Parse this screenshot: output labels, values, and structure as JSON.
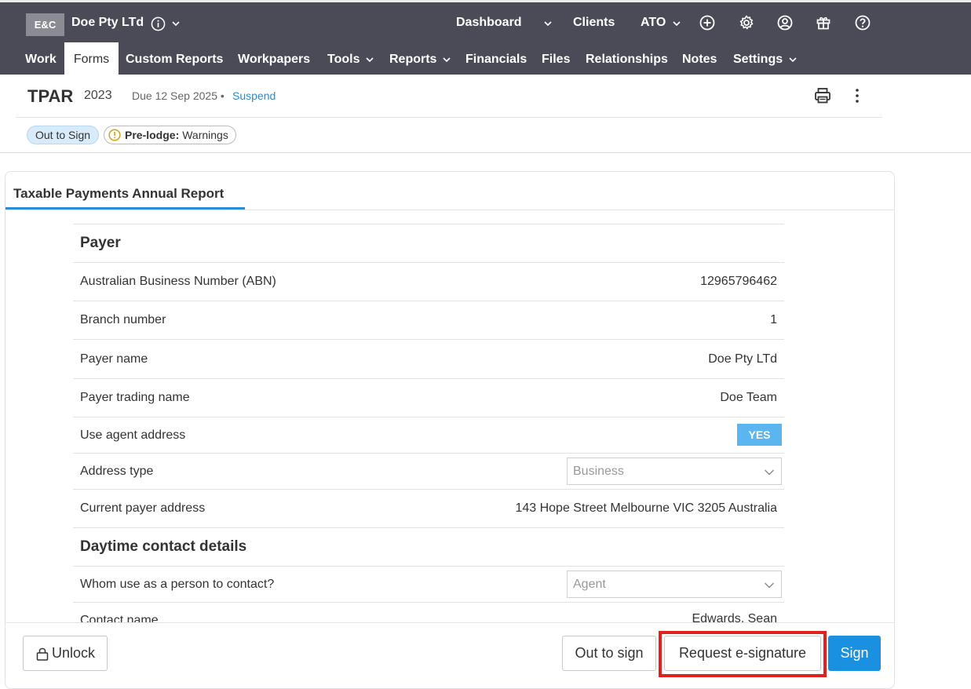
{
  "header": {
    "logo": "E&C",
    "client_name": "Doe Pty LTd",
    "links": {
      "dashboard": "Dashboard",
      "clients": "Clients",
      "ato": "ATO"
    },
    "nav": {
      "work": "Work",
      "forms": "Forms",
      "custom_reports": "Custom Reports",
      "workpapers": "Workpapers",
      "tools": "Tools",
      "reports": "Reports",
      "financials": "Financials",
      "files": "Files",
      "relationships": "Relationships",
      "notes": "Notes",
      "settings": "Settings"
    },
    "icons": [
      "info-icon",
      "plus-circle-icon",
      "gear-icon",
      "user-circle-icon",
      "gift-icon",
      "help-icon"
    ]
  },
  "form_header": {
    "title": "TPAR",
    "year": "2023",
    "due": "Due 12 Sep 2025 •",
    "suspend": "Suspend",
    "badges": {
      "status": "Out to Sign",
      "prelodge_label": "Pre-lodge:",
      "prelodge_value": "Warnings"
    }
  },
  "card": {
    "tab": "Taxable Payments Annual Report",
    "sections": {
      "payer": "Payer",
      "contact": "Daytime contact details"
    },
    "rows": {
      "abn": {
        "label": "Australian Business Number (ABN)",
        "value": "12965796462"
      },
      "branch": {
        "label": "Branch number",
        "value": "1"
      },
      "payer_name": {
        "label": "Payer name",
        "value": "Doe Pty LTd"
      },
      "trading_name": {
        "label": "Payer trading name",
        "value": "Doe Team"
      },
      "agent_address": {
        "label": "Use agent address",
        "value": "YES"
      },
      "address_type": {
        "label": "Address type",
        "value": "Business"
      },
      "current_address": {
        "label": "Current payer address",
        "value": "143 Hope Street Melbourne VIC 3205 Australia"
      },
      "whom_contact": {
        "label": "Whom use as a person to contact?",
        "value": "Agent"
      },
      "contact_name": {
        "label": "Contact name",
        "value": "Edwards, Sean"
      }
    }
  },
  "footer": {
    "unlock": "Unlock",
    "out_to_sign": "Out to sign",
    "request_esignature": "Request e-signature",
    "sign": "Sign"
  },
  "colors": {
    "header_bg": "#4a4b57",
    "accent": "#2a8dd4",
    "sign_button": "#1a90e0",
    "yes_toggle": "#5bb6ef",
    "highlight": "#e0221f"
  }
}
